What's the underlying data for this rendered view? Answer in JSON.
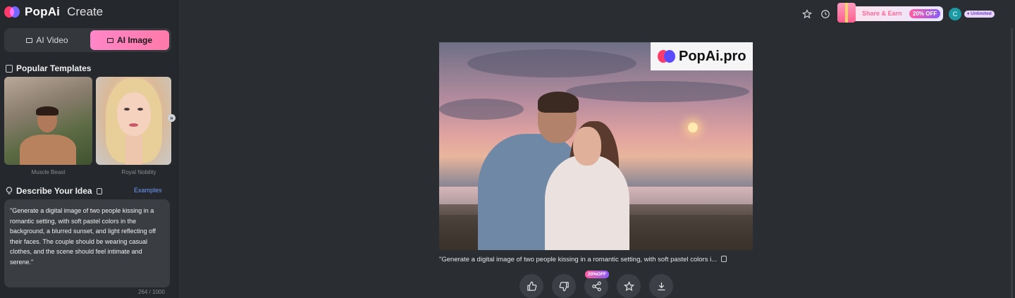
{
  "brand": {
    "name": "PopAi",
    "section": "Create"
  },
  "modes": {
    "video": "AI Video",
    "image": "AI Image",
    "active": "AI Image"
  },
  "templates": {
    "title": "Popular Templates",
    "items": [
      {
        "caption": "Muscle Beast"
      },
      {
        "caption": "Royal Nobility"
      }
    ],
    "next_icon": "chevron-right-icon"
  },
  "describe": {
    "title": "Describe Your Idea",
    "examples_label": "Examples",
    "prompt": "\"Generate a digital image of two people kissing in a romantic setting, with soft pastel colors in the background, a blurred sunset, and light reflecting off their faces. The couple should be wearing casual clothes, and the scene should feel intimate and serene.\"",
    "counter": "264 / 1000"
  },
  "topbar": {
    "share_label": "Share & Earn",
    "discount": "20% OFF",
    "avatar_initial": "C",
    "plan": "Unlimited"
  },
  "result": {
    "watermark": "PopAi.pro",
    "caption": "\"Generate a digital image of two people kissing in a romantic setting, with soft pastel colors i...",
    "share_promo": "20%OFF",
    "actions": [
      "thumbs-up-icon",
      "thumbs-down-icon",
      "share-icon",
      "star-icon",
      "download-icon"
    ]
  },
  "colors": {
    "accent_pink": "#ff86c9",
    "link_blue": "#6f9cff",
    "background": "#2a2e33",
    "sidebar": "#25282c"
  }
}
